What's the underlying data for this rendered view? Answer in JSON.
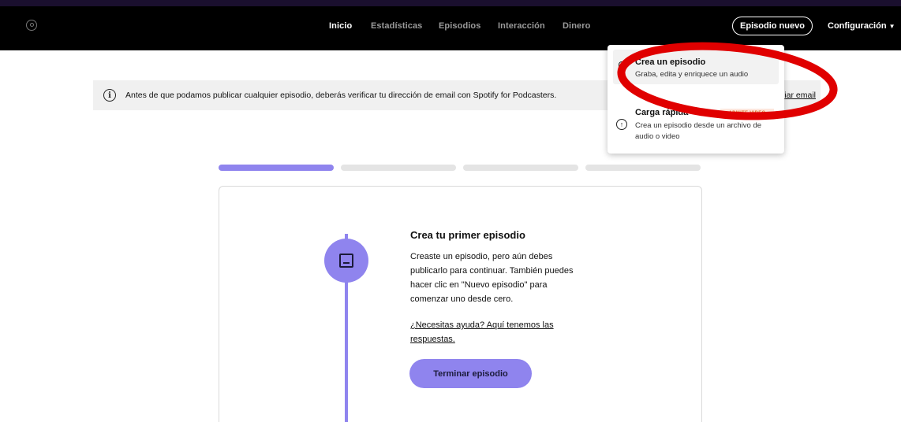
{
  "nav": {
    "items": [
      "Inicio",
      "Estadísticas",
      "Episodios",
      "Interacción",
      "Dinero"
    ],
    "new_episode_label": "Episodio nuevo",
    "settings_label": "Configuración",
    "settings_caret": "▼"
  },
  "alert": {
    "icon": "i",
    "text": "Antes de que podamos publicar cualquier episodio, deberás verificar tu dirección de email con Spotify for Podcasters.",
    "link_label": "iar email"
  },
  "progress": {
    "steps_total": 4,
    "steps_done": 1
  },
  "card": {
    "title": "Crea tu primer episodio",
    "description": "Creaste un episodio, pero aún debes publicarlo para continuar. También puedes hacer clic en \"Nuevo episodio\" para comenzar uno desde cero.",
    "help_link": "¿Necesitas ayuda? Aquí tenemos las respuestas.",
    "button_label": "Terminar episodio"
  },
  "dropdown": {
    "items": [
      {
        "title": "Crea un episodio",
        "subtitle": "Graba, edita y enriquece un audio",
        "icon": "microphone-icon"
      },
      {
        "title": "Carga rápida",
        "subtitle": "Crea un episodio desde un archivo de audio o video",
        "icon": "upload-icon",
        "badge": "ADMITE VIDEO"
      }
    ]
  },
  "colors": {
    "accent": "#8f84ee",
    "topbar": "#000000",
    "annotation_circle": "#e00000"
  }
}
